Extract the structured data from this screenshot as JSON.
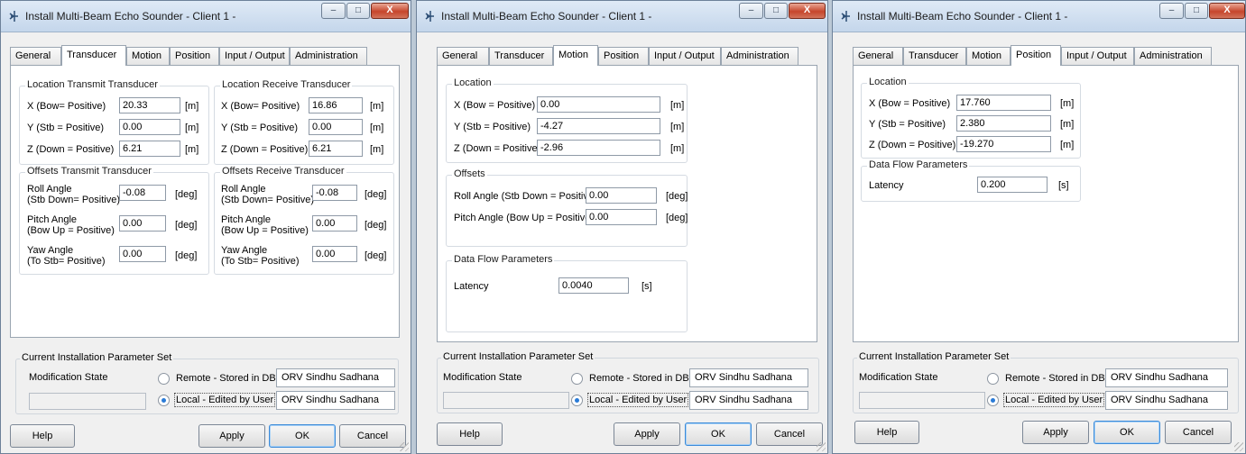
{
  "windows": [
    {
      "title": "Install Multi-Beam Echo Sounder - Client 1 -",
      "tabs": [
        "General",
        "Transducer",
        "Motion",
        "Position",
        "Input / Output",
        "Administration"
      ],
      "active_tab": "Transducer",
      "transducer": {
        "tx_location": {
          "title": "Location Transmit Transducer",
          "rows": [
            {
              "label": "X (Bow= Positive)",
              "value": "20.33",
              "unit": "[m]"
            },
            {
              "label": "Y (Stb = Positive)",
              "value": "0.00",
              "unit": "[m]"
            },
            {
              "label": "Z (Down = Positive)",
              "value": "6.21",
              "unit": "[m]"
            }
          ]
        },
        "rx_location": {
          "title": "Location Receive Transducer",
          "rows": [
            {
              "label": "X (Bow= Positive)",
              "value": "16.86",
              "unit": "[m]"
            },
            {
              "label": "Y (Stb = Positive)",
              "value": "0.00",
              "unit": "[m]"
            },
            {
              "label": "Z (Down = Positive)",
              "value": "6.21",
              "unit": "[m]"
            }
          ]
        },
        "tx_offsets": {
          "title": "Offsets Transmit Transducer",
          "rows": [
            {
              "label1": "Roll Angle",
              "label2": "(Stb Down= Positive)",
              "value": "-0.08",
              "unit": "[deg]"
            },
            {
              "label1": "Pitch Angle",
              "label2": "(Bow Up = Positive)",
              "value": "0.00",
              "unit": "[deg]"
            },
            {
              "label1": "Yaw Angle",
              "label2": "(To Stb= Positive)",
              "value": "0.00",
              "unit": "[deg]"
            }
          ]
        },
        "rx_offsets": {
          "title": "Offsets Receive Transducer",
          "rows": [
            {
              "label1": "Roll Angle",
              "label2": "(Stb Down= Positive)",
              "value": "-0.08",
              "unit": "[deg]"
            },
            {
              "label1": "Pitch Angle",
              "label2": "(Bow Up = Positive)",
              "value": "0.00",
              "unit": "[deg]"
            },
            {
              "label1": "Yaw Angle",
              "label2": "(To Stb= Positive)",
              "value": "0.00",
              "unit": "[deg]"
            }
          ]
        }
      }
    },
    {
      "title": "Install Multi-Beam Echo Sounder - Client 1 -",
      "tabs": [
        "General",
        "Transducer",
        "Motion",
        "Position",
        "Input / Output",
        "Administration"
      ],
      "active_tab": "Motion",
      "motion": {
        "location": {
          "title": "Location",
          "rows": [
            {
              "label": "X (Bow = Positive)",
              "value": "0.00",
              "unit": "[m]"
            },
            {
              "label": "Y (Stb = Positive)",
              "value": "-4.27",
              "unit": "[m]"
            },
            {
              "label": "Z (Down = Positive)",
              "value": "-2.96",
              "unit": "[m]"
            }
          ]
        },
        "offsets": {
          "title": "Offsets",
          "rows": [
            {
              "label": "Roll Angle (Stb Down = Positive)",
              "value": "0.00",
              "unit": "[deg]"
            },
            {
              "label": "Pitch Angle (Bow Up = Positive)",
              "value": "0.00",
              "unit": "[deg]"
            }
          ]
        },
        "data_flow": {
          "title": "Data Flow Parameters",
          "latency_label": "Latency",
          "latency_value": "0.0040",
          "latency_unit": "[s]"
        }
      }
    },
    {
      "title": "Install Multi-Beam Echo Sounder - Client 1 -",
      "tabs": [
        "General",
        "Transducer",
        "Motion",
        "Position",
        "Input / Output",
        "Administration"
      ],
      "active_tab": "Position",
      "position": {
        "location": {
          "title": "Location",
          "rows": [
            {
              "label": "X (Bow = Positive)",
              "value": "17.760",
              "unit": "[m]"
            },
            {
              "label": "Y (Stb = Positive)",
              "value": "2.380",
              "unit": "[m]"
            },
            {
              "label": "Z (Down = Positive)",
              "value": "-19.270",
              "unit": "[m]"
            }
          ]
        },
        "data_flow": {
          "title": "Data Flow Parameters",
          "latency_label": "Latency",
          "latency_value": "0.200",
          "latency_unit": "[s]"
        }
      }
    }
  ],
  "install_set": {
    "title": "Current Installation Parameter Set",
    "modification_state_label": "Modification State",
    "remote_label": "Remote - Stored in DB",
    "local_label": "Local - Edited by User",
    "remote_value": "ORV Sindhu Sadhana",
    "local_value": "ORV Sindhu Sadhana",
    "selected": "local"
  },
  "buttons": {
    "help": "Help",
    "apply": "Apply",
    "ok": "OK",
    "cancel": "Cancel"
  },
  "window_controls": {
    "minimize": "–",
    "maximize": "□",
    "close": "X"
  }
}
